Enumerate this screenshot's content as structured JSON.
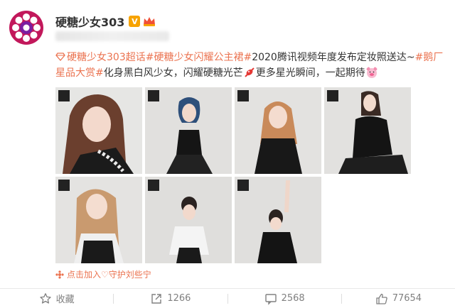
{
  "user": {
    "name": "硬糖少女303",
    "verified_badge": "V"
  },
  "post": {
    "segments": [
      {
        "text": "硬糖少女303超话",
        "kind": "topic"
      },
      {
        "text": "#硬糖少女闪耀公主裙#",
        "kind": "topic"
      },
      {
        "text": "2020腾讯视频年度发布定妆照送达~",
        "kind": "plain"
      },
      {
        "text": "#鹅厂星品大赏#",
        "kind": "topic"
      },
      {
        "text": "化身黑白风少女，闪耀硬糖光芒",
        "kind": "plain"
      },
      {
        "text": "更多星光瞬间，一起期待",
        "kind": "plain"
      }
    ],
    "link_color": "#eb7350"
  },
  "photos": [
    {
      "name": "photo-1"
    },
    {
      "name": "photo-2"
    },
    {
      "name": "photo-3"
    },
    {
      "name": "photo-4"
    },
    {
      "name": "photo-5"
    },
    {
      "name": "photo-6"
    },
    {
      "name": "photo-7"
    }
  ],
  "location": {
    "text": "点击加入♡守护刘些宁"
  },
  "actions": {
    "favorite": {
      "label": "收藏",
      "icon": "star-icon"
    },
    "repost": {
      "count": "1266",
      "icon": "repost-icon"
    },
    "comment": {
      "count": "2568",
      "icon": "comment-icon"
    },
    "like": {
      "count": "77654",
      "icon": "thumbs-up-icon"
    }
  }
}
